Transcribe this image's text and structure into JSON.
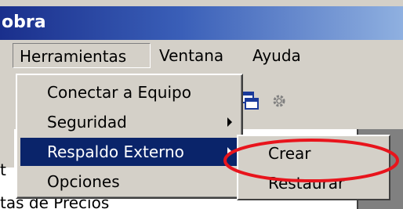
{
  "window": {
    "title": "obra"
  },
  "menubar": {
    "items": [
      "Herramientas",
      "Ventana",
      "Ayuda"
    ]
  },
  "menu_herramientas": {
    "items": [
      {
        "label": "Conectar a Equipo",
        "submenu": false
      },
      {
        "label": "Seguridad",
        "submenu": true
      },
      {
        "label": "Respaldo Externo",
        "submenu": true,
        "selected": true
      },
      {
        "label": "Opciones",
        "submenu": false
      }
    ]
  },
  "submenu_respaldo": {
    "items": [
      "Crear",
      "Restaurar"
    ]
  },
  "background": {
    "text1": "t",
    "text2": "tas de Precios"
  },
  "annotation": {
    "color": "#e8141c"
  },
  "colors": {
    "selection": "#0a246a",
    "face": "#d4d0c8"
  }
}
